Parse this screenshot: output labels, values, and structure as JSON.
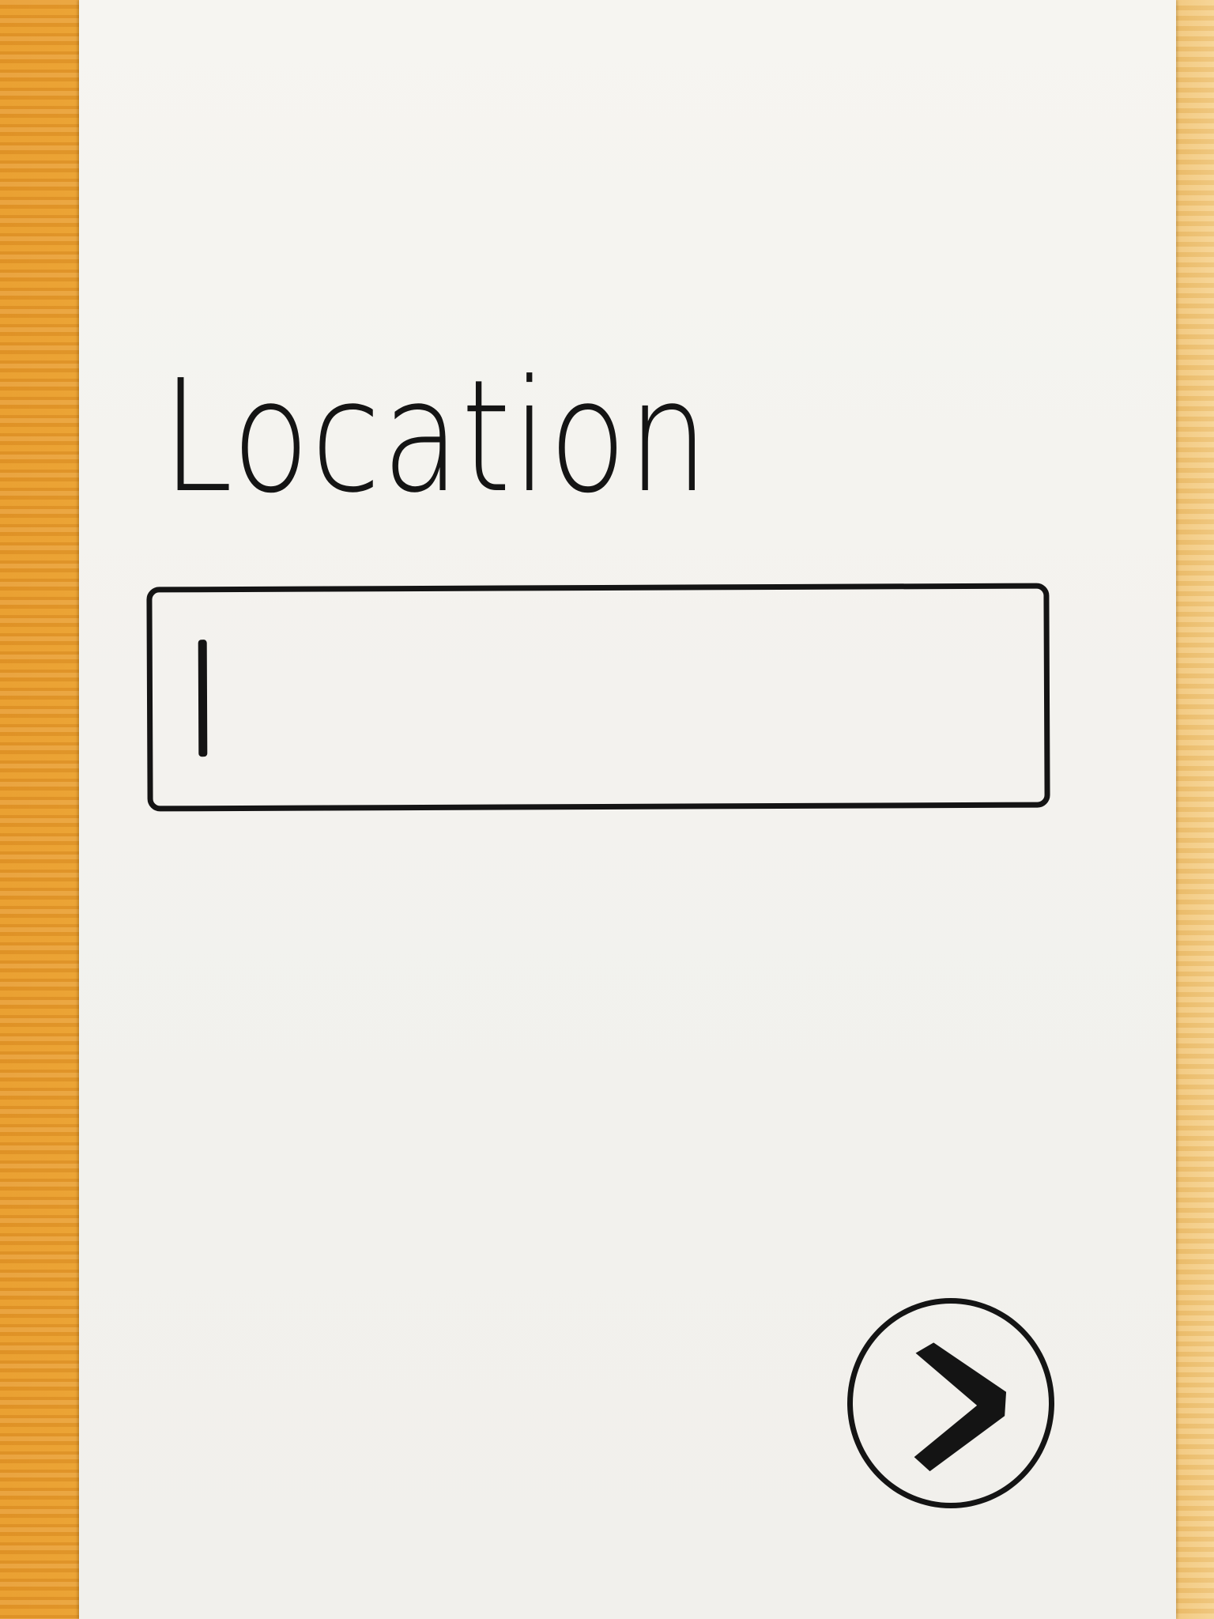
{
  "form": {
    "location_label": "Location",
    "location_value": ""
  },
  "next_button": {
    "icon": "chevron-right-icon"
  },
  "colors": {
    "ink": "#141414",
    "paper": "#f4f3ef",
    "wood": "#eba338"
  }
}
